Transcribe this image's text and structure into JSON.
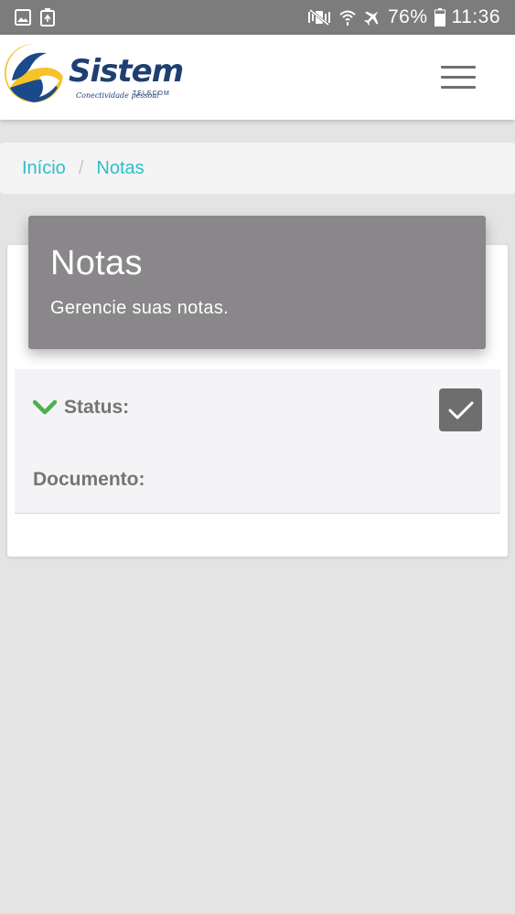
{
  "status_bar": {
    "battery": "76%",
    "time": "11:36",
    "icons": [
      "image-icon",
      "recycle-icon",
      "mute-icon",
      "wifi-icon",
      "airplane-icon",
      "battery-icon"
    ]
  },
  "brand": {
    "name": "Sistem",
    "tagline": "Conectividade pessoal",
    "sub": "TELECOM",
    "colors": {
      "navy": "#1f3f73",
      "yellow": "#f7c12a",
      "blue": "#1a4a8c"
    }
  },
  "breadcrumb": {
    "items": [
      "Início",
      "Notas"
    ],
    "separator": "/"
  },
  "card": {
    "title": "Notas",
    "subtitle": "Gerencie suas notas.",
    "status_label": "Status:",
    "document_label": "Documento:",
    "checked": true
  },
  "colors": {
    "accent": "#2cbfc9",
    "check_green": "#4caf50",
    "header_gray": "#898789"
  }
}
